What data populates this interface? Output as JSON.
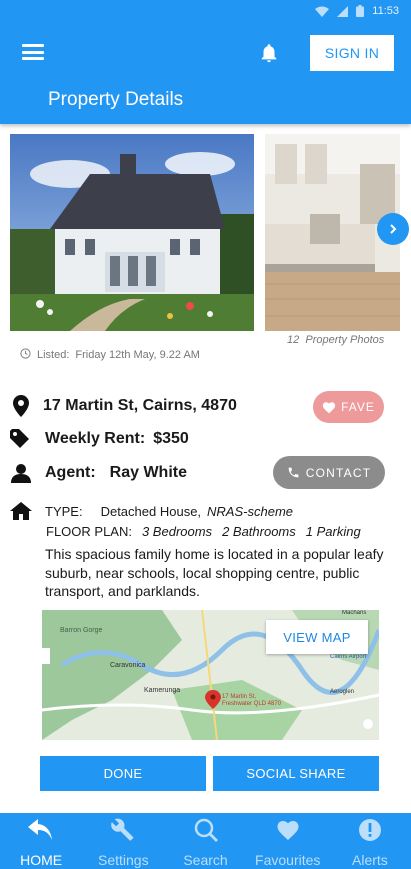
{
  "status_bar": {
    "time": "11:53"
  },
  "header": {
    "title": "Property Details",
    "signin_label": "SIGN IN"
  },
  "photos": {
    "caption_count": "12",
    "caption_text": "Property Photos"
  },
  "listing": {
    "listed_label": "Listed:",
    "listed_date": "Friday 12th May, 9.22 AM",
    "address": "17 Martin St, Cairns, 4870",
    "rent_label": "Weekly Rent:",
    "rent_value": "$350",
    "agent_label": "Agent:",
    "agent_value": "Ray White",
    "fave_label": "FAVE",
    "contact_label": "CONTACT",
    "type_label": "TYPE:",
    "type_value": "Detached House,",
    "type_scheme": "NRAS-scheme",
    "floorplan_label": "FLOOR PLAN:",
    "bedrooms": "3 Bedrooms",
    "bathrooms": "2 Bathrooms",
    "parking": "1 Parking",
    "description": "This spacious family home is located in a popular leafy suburb, near schools, local shopping centre, public transport, and parklands."
  },
  "map": {
    "view_map_label": "VIEW MAP",
    "labels": {
      "barron_gorge": "Barron Gorge",
      "caravonica": "Caravonica",
      "kamerunga": "Kamerunga",
      "cairns_airport": "Cairns Airport",
      "aeroglen": "Aeroglen",
      "machans": "Machans",
      "pin_line1": "17 Martin St,",
      "pin_line2": "Freshwater QLD 4870"
    }
  },
  "actions": {
    "done_label": "DONE",
    "share_label": "SOCIAL SHARE"
  },
  "bottom_nav": [
    {
      "label": "HOME",
      "icon": "back-arrow-icon",
      "active": true
    },
    {
      "label": "Settings",
      "icon": "wrench-icon",
      "active": false
    },
    {
      "label": "Search",
      "icon": "search-icon",
      "active": false
    },
    {
      "label": "Favourites",
      "icon": "heart-icon",
      "active": false
    },
    {
      "label": "Alerts",
      "icon": "alert-icon",
      "active": false
    }
  ],
  "colors": {
    "primary": "#2196f3",
    "fave": "#ef9a9a",
    "contact": "#8c8c8c"
  }
}
